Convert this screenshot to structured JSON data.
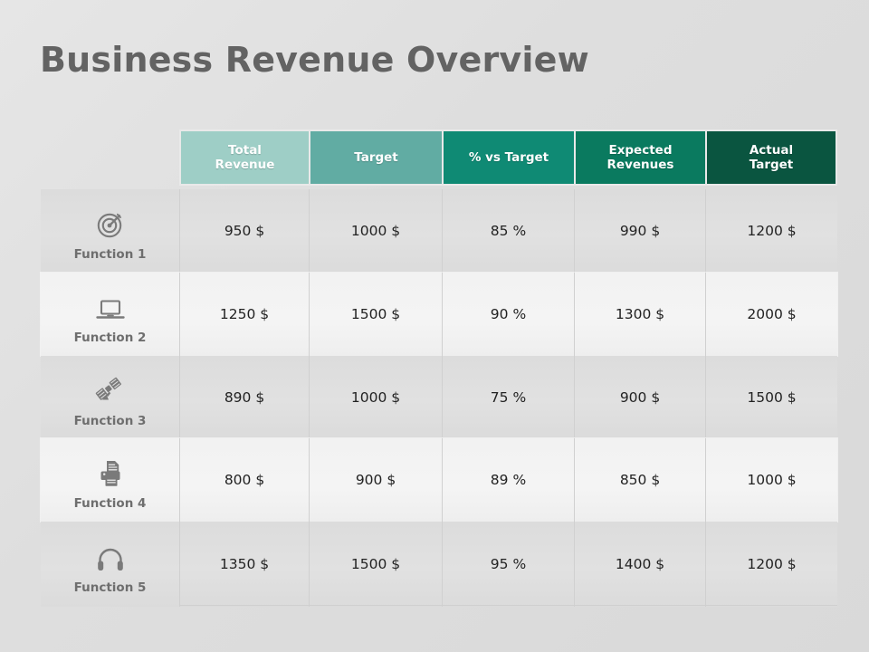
{
  "slide": {
    "title": "Business Revenue Overview",
    "background_color": "#dedede",
    "title_color": "#636363"
  },
  "table": {
    "row_label_header": "",
    "columns": [
      {
        "label": "Total\nRevenue",
        "line1": "Total",
        "line2": "Revenue",
        "color": "#9ecec6"
      },
      {
        "label": "Target",
        "line1": "Target",
        "line2": "",
        "color": "#61aca3"
      },
      {
        "label": "% vs Target",
        "line1": "% vs Target",
        "line2": "",
        "color": "#0f8a74"
      },
      {
        "label": "Expected\nRevenues",
        "line1": "Expected",
        "line2": "Revenues",
        "color": "#0a7a5f"
      },
      {
        "label": "Actual\nTarget",
        "line1": "Actual",
        "line2": "Target",
        "color": "#0a5540"
      }
    ],
    "rows": [
      {
        "label": "Function 1",
        "icon": "target-icon",
        "cells": [
          "950 $",
          "1000 $",
          "85 %",
          "990 $",
          "1200 $"
        ]
      },
      {
        "label": "Function 2",
        "icon": "laptop-icon",
        "cells": [
          "1250 $",
          "1500 $",
          "90 %",
          "1300 $",
          "2000 $"
        ]
      },
      {
        "label": "Function 3",
        "icon": "satellite-icon",
        "cells": [
          "890 $",
          "1000 $",
          "75 %",
          "900 $",
          "1500 $"
        ]
      },
      {
        "label": "Function 4",
        "icon": "printer-icon",
        "cells": [
          "800 $",
          "900 $",
          "89 %",
          "850 $",
          "1000 $"
        ]
      },
      {
        "label": "Function 5",
        "icon": "headphones-icon",
        "cells": [
          "1350 $",
          "1500 $",
          "95 %",
          "1400 $",
          "1200 $"
        ]
      }
    ]
  }
}
